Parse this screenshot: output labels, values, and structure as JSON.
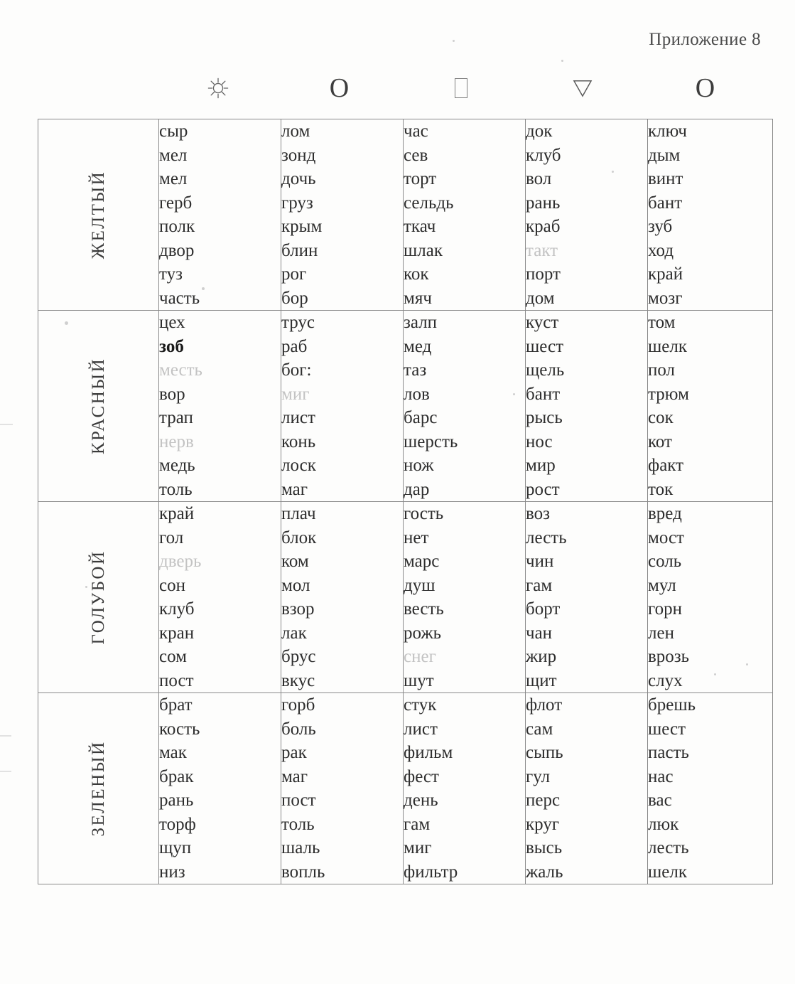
{
  "header": {
    "appendix_label": "Приложение 8"
  },
  "symbols": [
    {
      "name": "sun-symbol",
      "glyph": "☼"
    },
    {
      "name": "circle-symbol",
      "glyph": "O"
    },
    {
      "name": "rectangle-symbol",
      "glyph": "▯"
    },
    {
      "name": "triangle-down-symbol",
      "glyph": "∇"
    },
    {
      "name": "circle-symbol-2",
      "glyph": "O"
    }
  ],
  "rows": [
    {
      "label": "ЖЕЛТЫЙ",
      "columns": [
        [
          "сыр",
          "мел",
          "мел",
          "герб",
          "полк",
          "двор",
          "туз",
          "часть"
        ],
        [
          "лом",
          "зонд",
          "дочь",
          "груз",
          "крым",
          "блин",
          "рог",
          "бор"
        ],
        [
          "час",
          "сев",
          "торт",
          "сельдь",
          "ткач",
          "шлак",
          "кок",
          "мяч"
        ],
        [
          "док",
          "клуб",
          "вол",
          "рань",
          "краб",
          "такт",
          "порт",
          "дом"
        ],
        [
          "ключ",
          "дым",
          "винт",
          "бант",
          "зуб",
          "ход",
          "край",
          "мозг"
        ]
      ]
    },
    {
      "label": "КРАСНЫЙ",
      "columns": [
        [
          "цех",
          "зоб",
          "месть",
          "вор",
          "трап",
          "нерв",
          "медь",
          "толь"
        ],
        [
          "трус",
          "раб",
          "бог:",
          "миг",
          "лист",
          "конь",
          "лоск",
          "маг"
        ],
        [
          "залп",
          "мед",
          "таз",
          "лов",
          "барс",
          "шерсть",
          "нож",
          "дар"
        ],
        [
          "куст",
          "шест",
          "щель",
          "бант",
          "рысь",
          "нос",
          "мир",
          "рост"
        ],
        [
          "том",
          "шелк",
          "пол",
          "трюм",
          "сок",
          "кот",
          "факт",
          "ток"
        ]
      ]
    },
    {
      "label": "ГОЛУБОЙ",
      "columns": [
        [
          "край",
          "гол",
          "дверь",
          "сон",
          "клуб",
          "кран",
          "сом",
          "пост"
        ],
        [
          "плач",
          "блок",
          "ком",
          "мол",
          "взор",
          "лак",
          "брус",
          "вкус"
        ],
        [
          "гость",
          "нет",
          "марс",
          "душ",
          "весть",
          "рожь",
          "снег",
          "шут"
        ],
        [
          "воз",
          "лесть",
          "чин",
          "гам",
          "борт",
          "чан",
          "жир",
          "щит"
        ],
        [
          "вред",
          "мост",
          "соль",
          "мул",
          "горн",
          "лен",
          "врозь",
          "слух"
        ]
      ]
    },
    {
      "label": "ЗЕЛЕНЫЙ",
      "columns": [
        [
          "брат",
          "кость",
          "мак",
          "брак",
          "рань",
          "торф",
          "щуп",
          "низ"
        ],
        [
          "горб",
          "боль",
          "рак",
          "маг",
          "пост",
          "толь",
          "шаль",
          "вопль"
        ],
        [
          "стук",
          "лист",
          "фильм",
          "фест",
          "день",
          "гам",
          "миг",
          "фильтр"
        ],
        [
          "флот",
          "сам",
          "сыпь",
          "гул",
          "перс",
          "круг",
          "высь",
          "жаль"
        ],
        [
          "брешь",
          "шест",
          "пасть",
          "нас",
          "вас",
          "люк",
          "лесть",
          "шелк"
        ]
      ]
    }
  ],
  "faded_words": {
    "full": [
      "такт",
      "нерв",
      "миг",
      "дверь",
      "снег",
      "месть"
    ],
    "bold": [
      "зоб"
    ]
  },
  "colors": {
    "ink": "#2e2e2e",
    "faded_ink": "#c3c3c3",
    "rule": "#8a8a8a",
    "paper": "#fdfdfc"
  }
}
